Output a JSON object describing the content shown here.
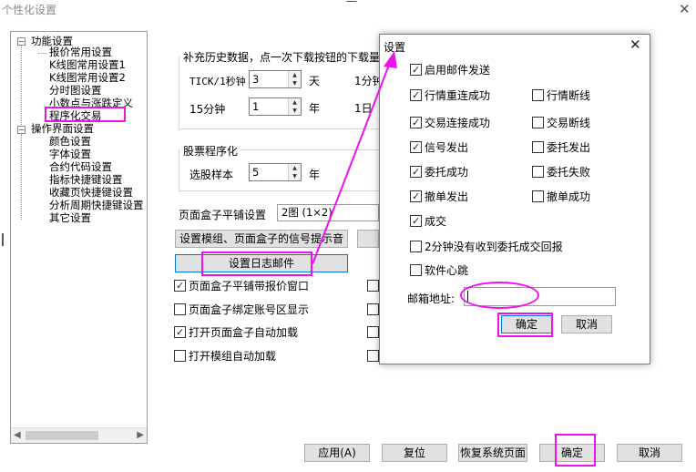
{
  "window": {
    "title": "个性化设置",
    "close_glyph": "✕",
    "caption_dash": "—"
  },
  "tree": {
    "nodes": [
      {
        "label": "功能设置",
        "toggle": "−"
      },
      {
        "label": "报价常用设置"
      },
      {
        "label": "K线图常用设置1"
      },
      {
        "label": "K线图常用设置2"
      },
      {
        "label": "分时图设置"
      },
      {
        "label": "小数点与涨跌定义"
      },
      {
        "label": "程序化交易"
      },
      {
        "label": "操作界面设置",
        "toggle": "−"
      },
      {
        "label": "颜色设置"
      },
      {
        "label": "字体设置"
      },
      {
        "label": "合约代码设置"
      },
      {
        "label": "指标快捷键设置"
      },
      {
        "label": "收藏页快捷键设置"
      },
      {
        "label": "分析周期快捷键设置"
      },
      {
        "label": "其它设置"
      }
    ],
    "scroll_left": "◀",
    "scroll_right": "▶"
  },
  "history": {
    "title": "补充历史数据，点一次下载按钮的下载量",
    "tick_label": "TICK/1秒钟",
    "tick_value": "3",
    "tick_unit": "天",
    "min1_label": "1分钟",
    "min15_label": "15分钟",
    "min15_value": "1",
    "min15_unit": "年",
    "day_label": "1日"
  },
  "stock": {
    "title": "股票程序化",
    "sample_label": "选股样本",
    "sample_value": "5",
    "sample_unit": "年"
  },
  "tile": {
    "label": "页面盒子平铺设置",
    "value": "2图 (1×2)"
  },
  "buttons": {
    "signal_sound": "设置模组、页面盒子的信号提示音",
    "log_email": "设置日志邮件",
    "apply": "应用(A)",
    "reset": "复位",
    "restore": "恢复系统页面",
    "ok": "确定",
    "cancel": "取消"
  },
  "checks": [
    {
      "label": "页面盒子平铺带报价窗口",
      "checked": true
    },
    {
      "label": "页面盒子绑定账号区显示",
      "checked": false
    },
    {
      "label": "打开页面盒子自动加载",
      "checked": true
    },
    {
      "label": "打开模组自动加载",
      "checked": false
    }
  ],
  "dialog": {
    "title": "设置",
    "close_glyph": "✕",
    "enable_email": {
      "label": "启用邮件发送",
      "checked": true
    },
    "rows": [
      [
        {
          "label": "行情重连成功",
          "checked": true
        },
        {
          "label": "行情断线",
          "checked": false
        }
      ],
      [
        {
          "label": "交易连接成功",
          "checked": true
        },
        {
          "label": "交易断线",
          "checked": false
        }
      ],
      [
        {
          "label": "信号发出",
          "checked": true
        },
        {
          "label": "委托发出",
          "checked": false
        }
      ],
      [
        {
          "label": "委托成功",
          "checked": true
        },
        {
          "label": "委托失败",
          "checked": false
        }
      ],
      [
        {
          "label": "撤单发出",
          "checked": true
        },
        {
          "label": "撤单成功",
          "checked": false
        }
      ]
    ],
    "deal": {
      "label": "成交",
      "checked": true
    },
    "no_report": {
      "label": "2分钟没有收到委托成交回报",
      "checked": false
    },
    "heartbeat": {
      "label": "软件心跳",
      "checked": false
    },
    "email_label": "邮箱地址:",
    "email_value": "",
    "ok": "确定",
    "cancel": "取消"
  },
  "colors": {
    "annotation": "#ee11ee",
    "focus": "#0078d7"
  }
}
